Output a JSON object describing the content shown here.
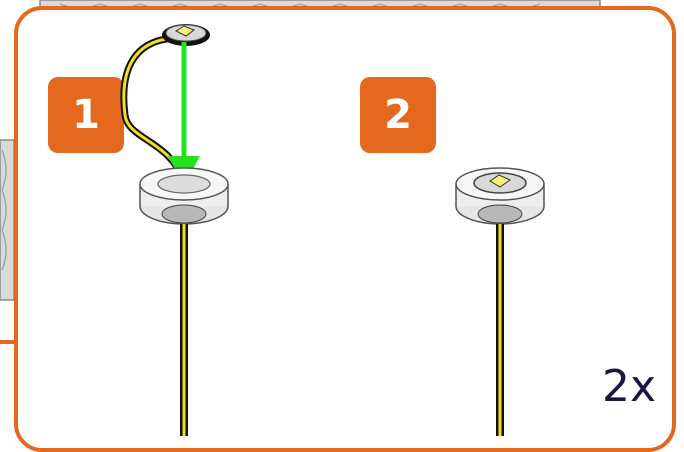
{
  "steps": [
    {
      "number": "1"
    },
    {
      "number": "2"
    }
  ],
  "quantity_label": "2x",
  "colors": {
    "accent": "#e4691e",
    "arrow": "#22e21f",
    "cable": "#f2e020",
    "text": "#1c1742"
  }
}
